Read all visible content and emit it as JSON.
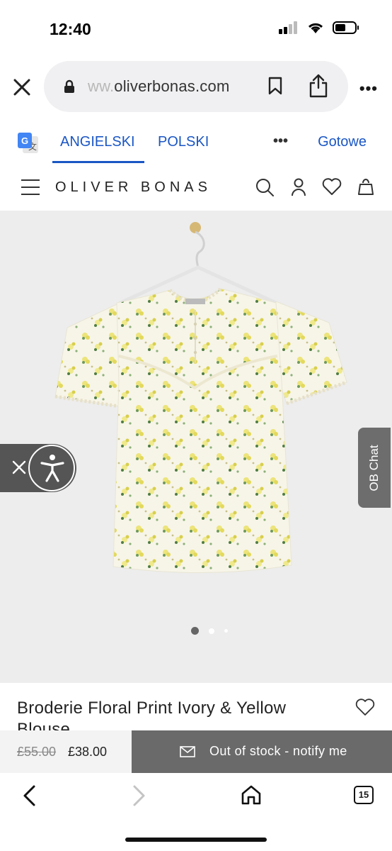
{
  "status_bar": {
    "time": "12:40"
  },
  "browser": {
    "url_faded": "ww.",
    "url_main": "oliverbonas.com",
    "tab_count": "15"
  },
  "translate": {
    "active_lang": "ANGIELSKI",
    "other_lang": "POLSKI",
    "more": "•••",
    "done": "Gotowe"
  },
  "site": {
    "brand": "OLIVER BONAS"
  },
  "product": {
    "title": "Broderie Floral Print Ivory & Yellow Blouse",
    "was_price": "£55.00",
    "price": "£38.00",
    "notify_label": "Out of stock - notify me"
  },
  "chat": {
    "label": "OB Chat"
  },
  "carousel": {
    "current": 1,
    "total": 3
  },
  "colors": {
    "accent": "#1a56c4",
    "hero_bg": "#ededed",
    "notify_bg": "#6a6a6a"
  }
}
